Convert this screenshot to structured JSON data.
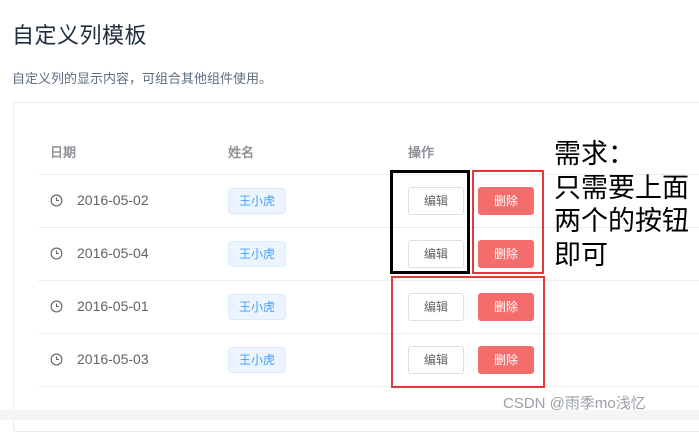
{
  "page": {
    "title": "自定义列模板",
    "description": "自定义列的显示内容，可组合其他组件使用。"
  },
  "table": {
    "columns": [
      "日期",
      "姓名",
      "操作"
    ],
    "rows": [
      {
        "date": "2016-05-02",
        "name": "王小虎",
        "edit": "编辑",
        "delete": "删除"
      },
      {
        "date": "2016-05-04",
        "name": "王小虎",
        "edit": "编辑",
        "delete": "删除"
      },
      {
        "date": "2016-05-01",
        "name": "王小虎",
        "edit": "编辑",
        "delete": "删除"
      },
      {
        "date": "2016-05-03",
        "name": "王小虎",
        "edit": "编辑",
        "delete": "删除"
      }
    ]
  },
  "annotation": {
    "lines": [
      "需求：",
      "只需要上面",
      "两个的按钮",
      "即可"
    ]
  },
  "watermark": "CSDN @雨季mo浅忆",
  "icons": {
    "date": "clock-icon"
  },
  "colors": {
    "tag_text": "#409eff",
    "tag_bg": "#ecf5ff",
    "delete_bg": "#f56c6c",
    "highlight_red": "#e53935",
    "highlight_black": "#000000"
  }
}
